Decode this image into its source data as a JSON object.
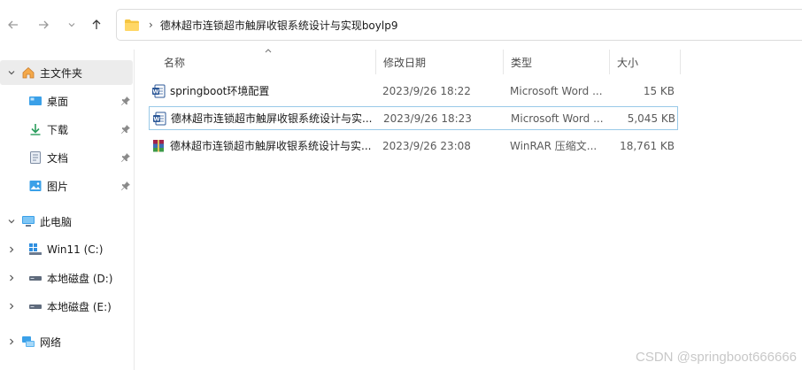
{
  "nav": {
    "back_icon": "arrow-left-icon",
    "forward_icon": "arrow-right-icon",
    "recent_icon": "chevron-down-icon",
    "up_icon": "arrow-up-icon"
  },
  "address": {
    "separator": "›",
    "path": "德林超市连锁超市触屏收银系统设计与实现boylp9"
  },
  "sidebar": {
    "home": "主文件夹",
    "quick": [
      {
        "label": "桌面",
        "icon": "desktop-icon"
      },
      {
        "label": "下载",
        "icon": "download-icon"
      },
      {
        "label": "文档",
        "icon": "document-icon"
      },
      {
        "label": "图片",
        "icon": "picture-icon"
      }
    ],
    "thispc": "此电脑",
    "drives": [
      {
        "label": "Win11 (C:)"
      },
      {
        "label": "本地磁盘 (D:)"
      },
      {
        "label": "本地磁盘 (E:)"
      }
    ],
    "network": "网络"
  },
  "columns": {
    "name": "名称",
    "date": "修改日期",
    "type": "类型",
    "size": "大小"
  },
  "files": [
    {
      "name": "springboot环境配置",
      "date": "2023/9/26 18:22",
      "type": "Microsoft Word ...",
      "size": "15 KB",
      "icon": "word-icon"
    },
    {
      "name": "德林超市连锁超市触屏收银系统设计与实...",
      "date": "2023/9/26 18:23",
      "type": "Microsoft Word ...",
      "size": "5,045 KB",
      "icon": "word-icon"
    },
    {
      "name": "德林超市连锁超市触屏收银系统设计与实...",
      "date": "2023/9/26 23:08",
      "type": "WinRAR 压缩文...",
      "size": "18,761 KB",
      "icon": "winrar-icon"
    }
  ],
  "watermark": "CSDN @springboot666666",
  "colors": {
    "folder": "#f5c542",
    "word": "#2b5797",
    "selection_border": "#99c9e8",
    "accent": "#0078d4"
  }
}
